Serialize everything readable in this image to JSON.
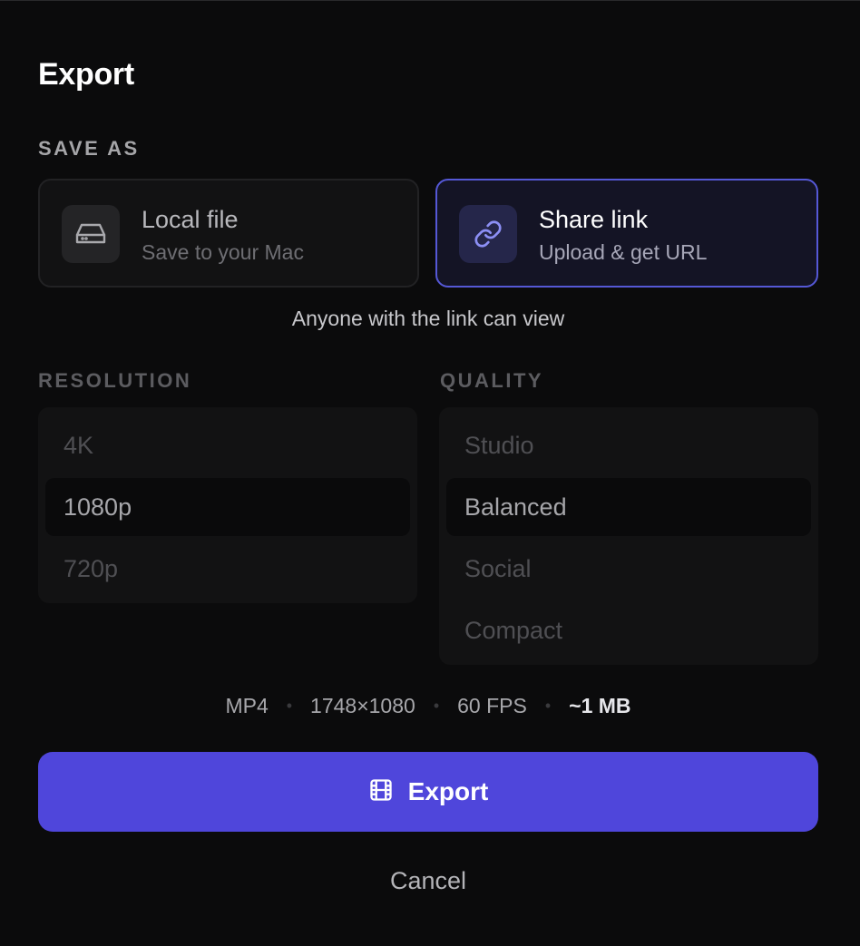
{
  "dialog": {
    "title": "Export"
  },
  "save_as": {
    "label": "SAVE AS",
    "options": [
      {
        "title": "Local file",
        "subtitle": "Save to your Mac",
        "icon": "hard-drive-icon",
        "selected": false
      },
      {
        "title": "Share link",
        "subtitle": "Upload & get URL",
        "icon": "link-icon",
        "selected": true
      }
    ],
    "note": "Anyone with the link can view"
  },
  "resolution": {
    "label": "RESOLUTION",
    "options": [
      "4K",
      "1080p",
      "720p"
    ],
    "selected": "1080p"
  },
  "quality": {
    "label": "QUALITY",
    "options": [
      "Studio",
      "Balanced",
      "Social",
      "Compact"
    ],
    "selected": "Balanced"
  },
  "meta": {
    "format": "MP4",
    "dimensions": "1748×1080",
    "fps": "60 FPS",
    "size": "~1 MB",
    "separator": "•"
  },
  "actions": {
    "export_label": "Export",
    "export_icon": "film-icon",
    "cancel_label": "Cancel"
  },
  "colors": {
    "accent": "#4f46db",
    "selected_border": "#5558d6",
    "background": "#0b0b0c"
  }
}
